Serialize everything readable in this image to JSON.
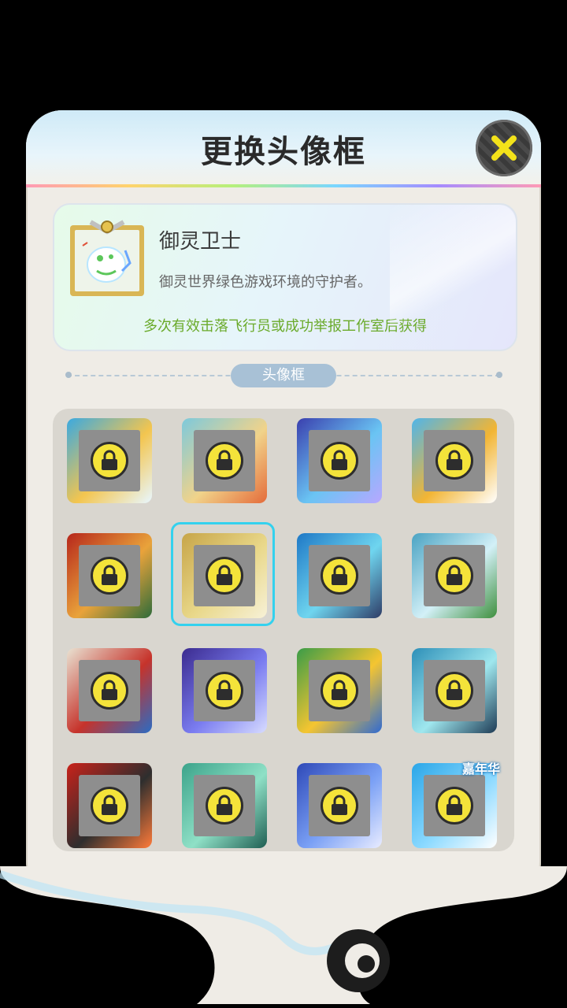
{
  "header": {
    "title": "更换头像框",
    "close_icon": "close-x-icon"
  },
  "selected_frame": {
    "name": "御灵卫士",
    "description": "御灵世界绿色游戏环境的守护者。",
    "source": "多次有效击落飞行员或成功举报工作室后获得"
  },
  "section": {
    "label": "头像框"
  },
  "frames": [
    {
      "name": "frame-ocean-wave",
      "colors": [
        "#3aa9e0",
        "#f3c54f",
        "#e8f7ff"
      ],
      "locked": true,
      "selected": false
    },
    {
      "name": "frame-crab-beach",
      "colors": [
        "#7cc9dc",
        "#f1d38a",
        "#e46b3a"
      ],
      "locked": true,
      "selected": false
    },
    {
      "name": "frame-blue-dragon",
      "colors": [
        "#3a3fae",
        "#6ac4f3",
        "#b8a7ff"
      ],
      "locked": true,
      "selected": false
    },
    {
      "name": "frame-summer-bear",
      "colors": [
        "#4fb5ea",
        "#f2b534",
        "#ffffff"
      ],
      "locked": true,
      "selected": false
    },
    {
      "name": "frame-red-leaf",
      "colors": [
        "#b6261b",
        "#e9a33b",
        "#2e6b3a"
      ],
      "locked": true,
      "selected": false
    },
    {
      "name": "frame-guardian",
      "colors": [
        "#c7a548",
        "#e9d88a",
        "#f7f1d7"
      ],
      "locked": true,
      "selected": true
    },
    {
      "name": "frame-water-spirit",
      "colors": [
        "#1e78c6",
        "#6fd5ef",
        "#2e3c66"
      ],
      "locked": true,
      "selected": false
    },
    {
      "name": "frame-forest-pet",
      "colors": [
        "#4aa3c3",
        "#d3f0f7",
        "#3e8f3e"
      ],
      "locked": true,
      "selected": false
    },
    {
      "name": "frame-sport",
      "colors": [
        "#e9e2d2",
        "#c6332b",
        "#2b6cc4"
      ],
      "locked": true,
      "selected": false
    },
    {
      "name": "frame-star-night",
      "colors": [
        "#3b2b8f",
        "#7a7cf0",
        "#d7dcff"
      ],
      "locked": true,
      "selected": false
    },
    {
      "name": "frame-wechat",
      "colors": [
        "#3a9c48",
        "#f5c531",
        "#2f6ad2"
      ],
      "locked": true,
      "selected": false
    },
    {
      "name": "frame-ice-pop",
      "colors": [
        "#2d8fb8",
        "#9fe7ee",
        "#1e3b55"
      ],
      "locked": true,
      "selected": false
    },
    {
      "name": "frame-fire-horn",
      "colors": [
        "#c9221a",
        "#2e2e2e",
        "#ff7b3a"
      ],
      "locked": true,
      "selected": false
    },
    {
      "name": "frame-jade",
      "colors": [
        "#3ba38a",
        "#8fe0c6",
        "#1f5e52"
      ],
      "locked": true,
      "selected": false
    },
    {
      "name": "frame-moon-sea",
      "colors": [
        "#2e49b8",
        "#7aa0f5",
        "#e9ecff"
      ],
      "locked": true,
      "selected": false
    },
    {
      "name": "frame-carnival",
      "colors": [
        "#2aa6e8",
        "#8ad9ff",
        "#ffffff"
      ],
      "locked": true,
      "selected": false,
      "badge": "嘉年华"
    }
  ],
  "colors": {
    "selected_outline": "#34d1ee",
    "lock_yellow": "#f4e33a",
    "source_green": "#6aaa2a"
  }
}
